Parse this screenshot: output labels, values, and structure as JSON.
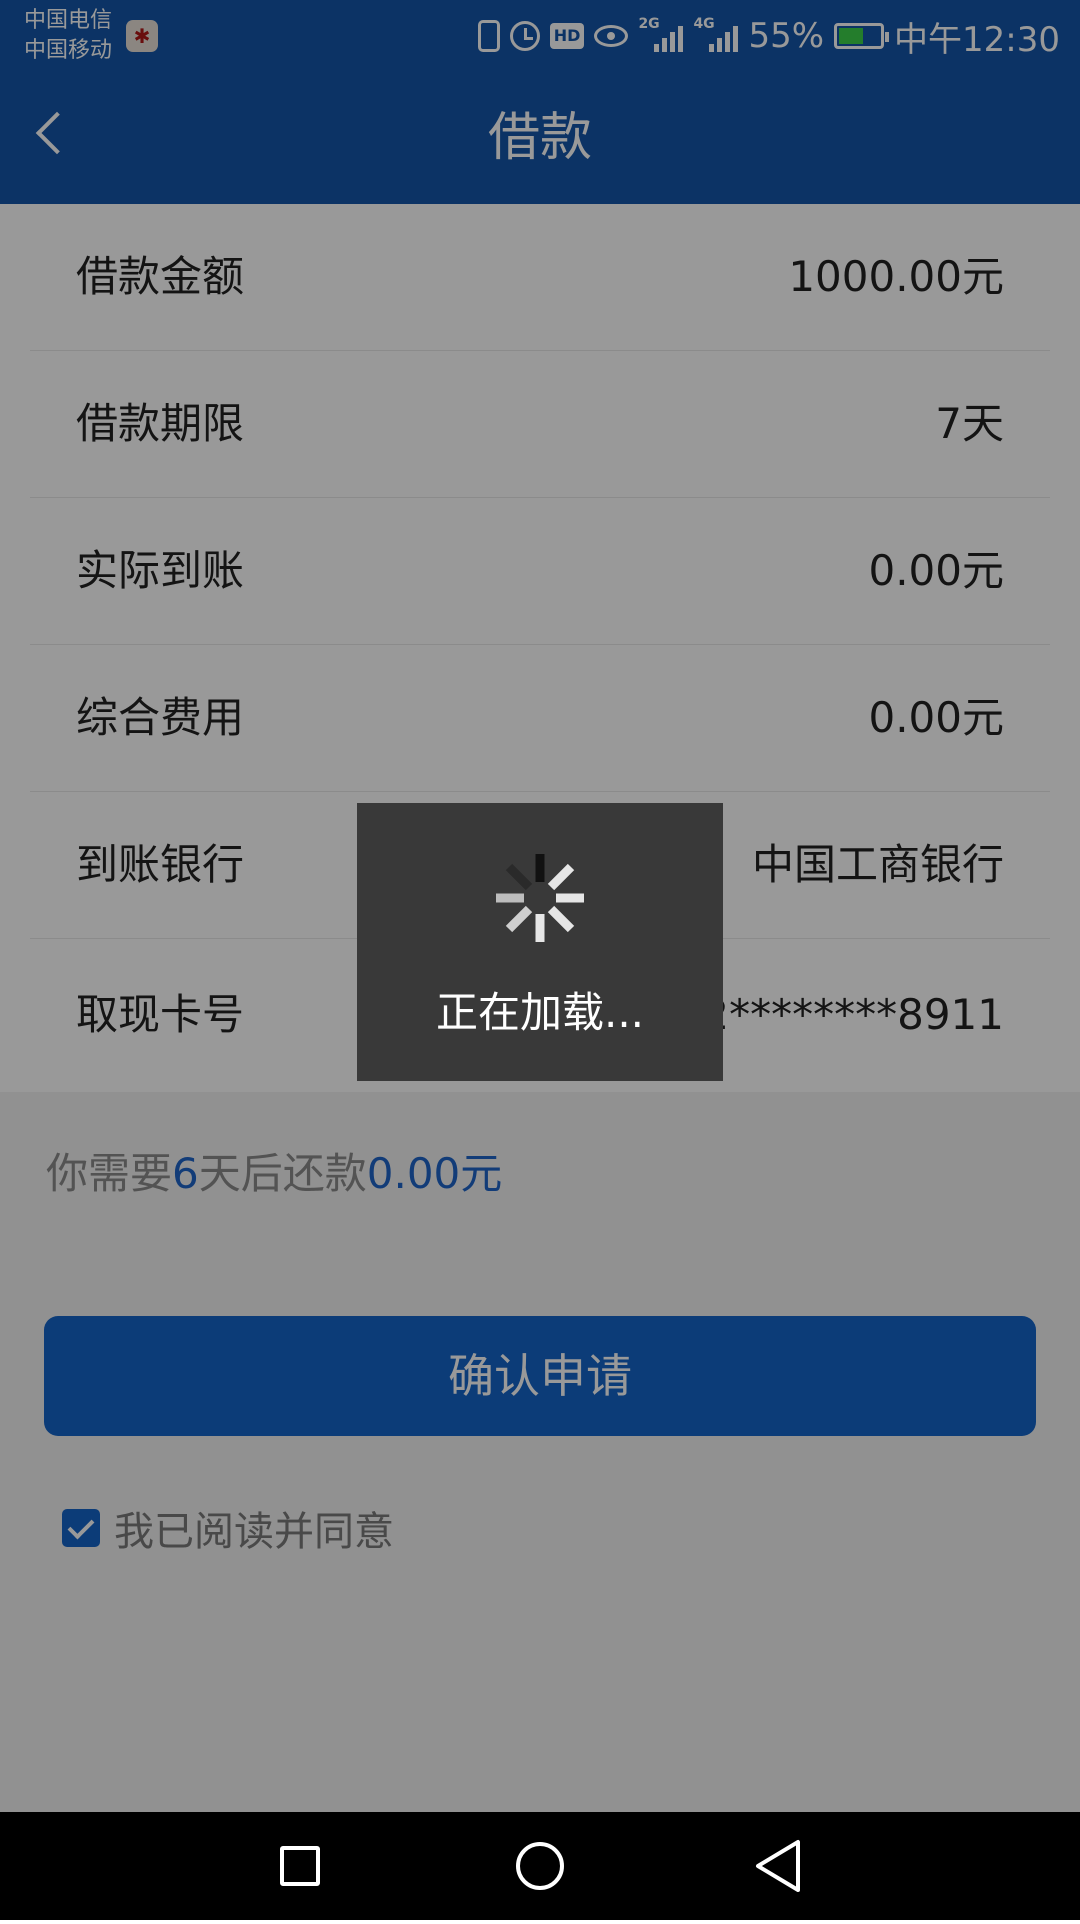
{
  "status_bar": {
    "carrier1": "中国电信",
    "carrier2": "中国移动",
    "network1": "2G",
    "network2": "4G",
    "hd": "HD",
    "battery": "55%",
    "time": "中午12:30"
  },
  "header": {
    "title": "借款"
  },
  "rows": [
    {
      "label": "借款金额",
      "value": "1000.00元"
    },
    {
      "label": "借款期限",
      "value": "7天"
    },
    {
      "label": "实际到账",
      "value": "0.00元"
    },
    {
      "label": "综合费用",
      "value": "0.00元"
    },
    {
      "label": "到账银行",
      "value": "中国工商银行"
    },
    {
      "label": "取现卡号",
      "value": "6212********8911"
    }
  ],
  "repay": {
    "prefix": "你需要",
    "days": "6",
    "middle": "天后还款",
    "amount": "0.00元"
  },
  "confirm_label": "确认申请",
  "agreement": {
    "checked": true,
    "text": "我已阅读并同意"
  },
  "loading": {
    "text": "正在加载..."
  },
  "colors": {
    "primary": "#1456a8",
    "accent": "#1565c8",
    "toast": "#393939"
  }
}
